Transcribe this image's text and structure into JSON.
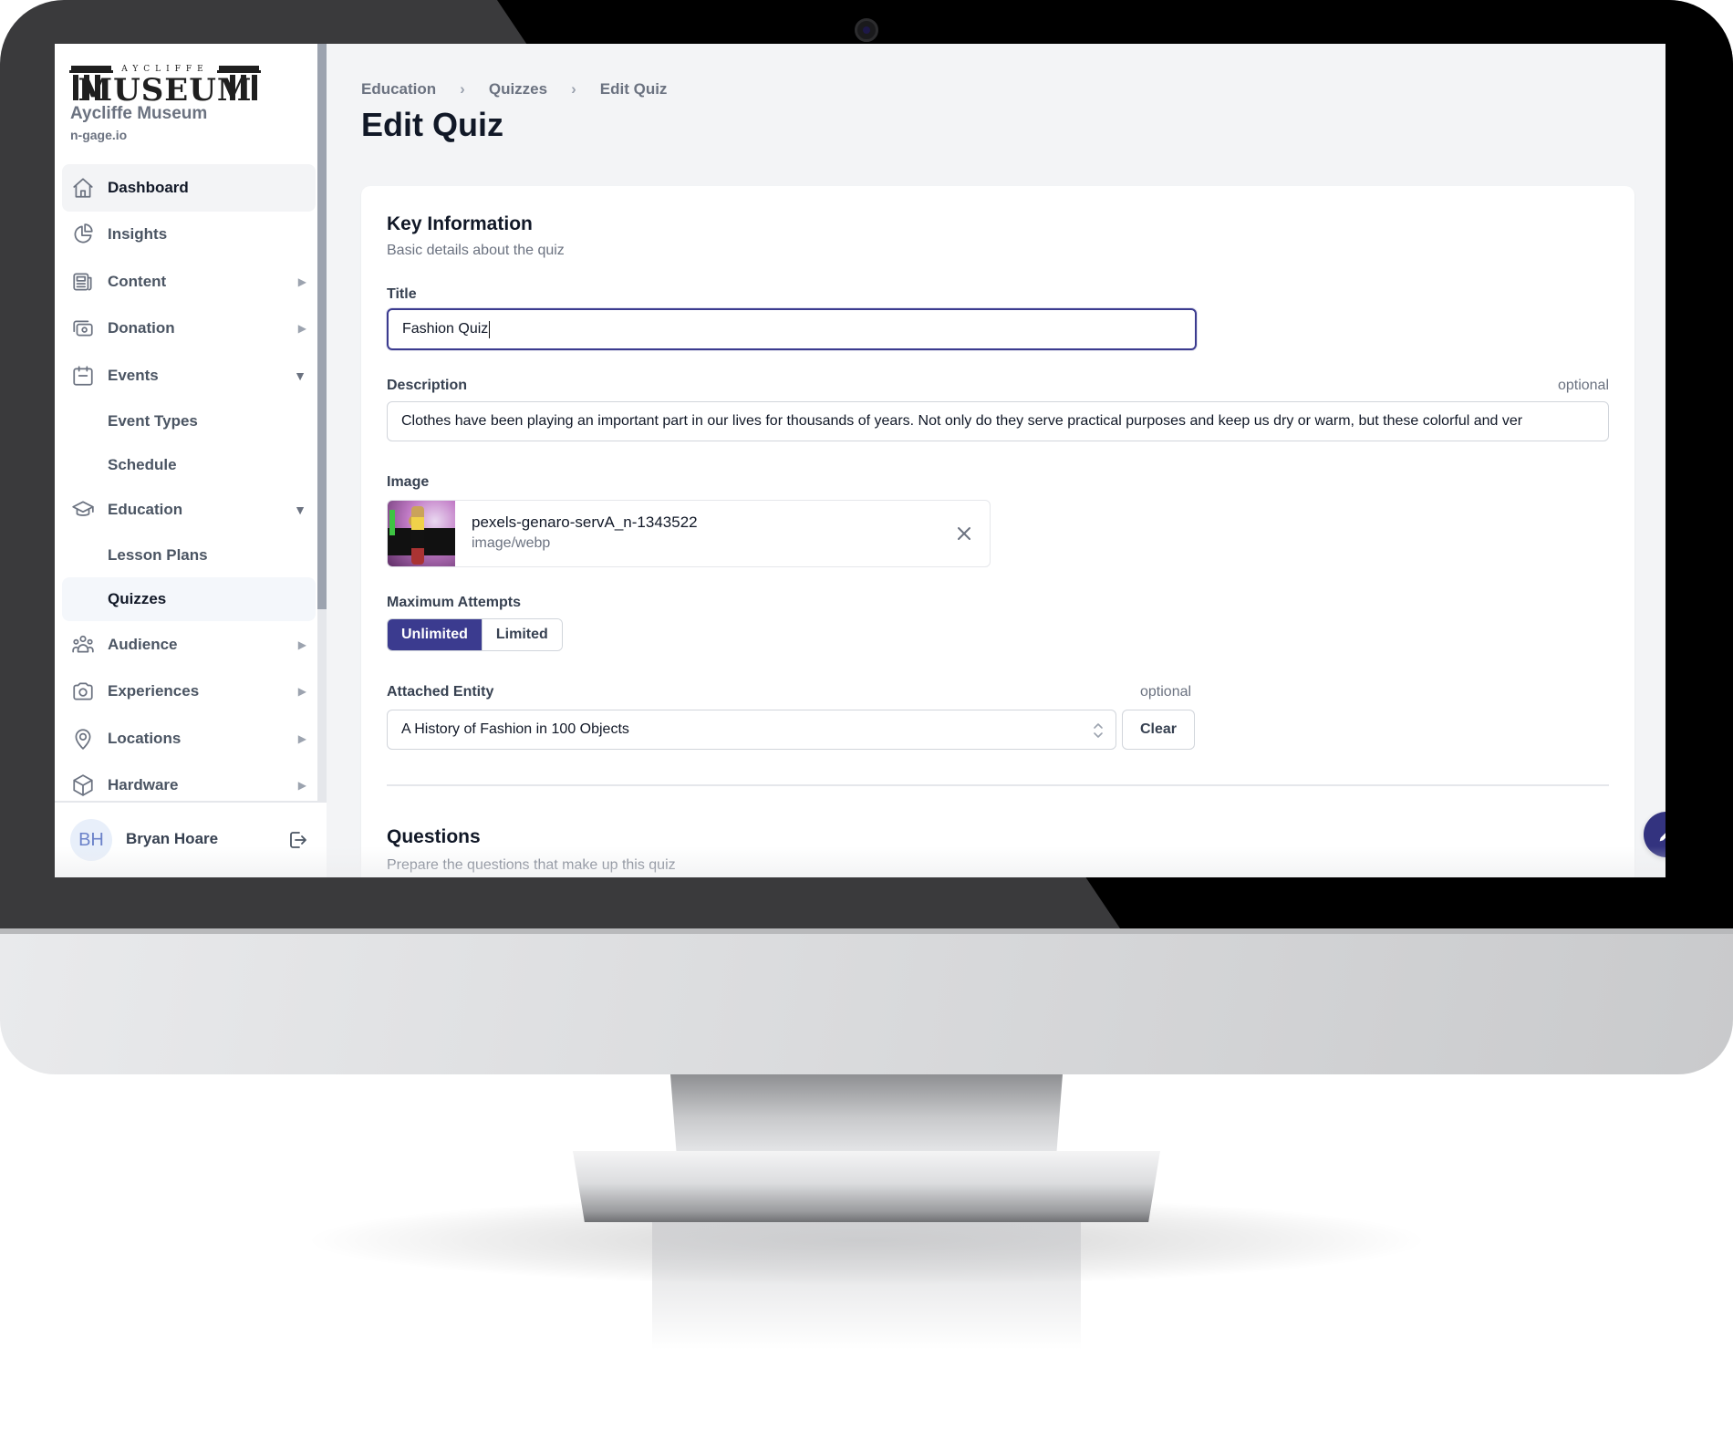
{
  "sidebar": {
    "logo": {
      "small_text": "AYCLIFFE",
      "big_text": "MUSEUM"
    },
    "org_name": "Aycliffe Museum",
    "org_domain": "n-gage.io",
    "items": [
      {
        "label": "Dashboard",
        "icon": "home-icon",
        "active": true
      },
      {
        "label": "Insights",
        "icon": "pie-chart-icon"
      },
      {
        "label": "Content",
        "icon": "newspaper-icon",
        "chevron": "right"
      },
      {
        "label": "Donation",
        "icon": "cash-icon",
        "chevron": "right"
      },
      {
        "label": "Events",
        "icon": "calendar-icon",
        "chevron": "down",
        "children": [
          {
            "label": "Event Types"
          },
          {
            "label": "Schedule"
          }
        ]
      },
      {
        "label": "Education",
        "icon": "academic-cap-icon",
        "chevron": "down",
        "children": [
          {
            "label": "Lesson Plans"
          },
          {
            "label": "Quizzes",
            "active": true
          }
        ]
      },
      {
        "label": "Audience",
        "icon": "user-group-icon",
        "chevron": "right"
      },
      {
        "label": "Experiences",
        "icon": "camera-icon",
        "chevron": "right"
      },
      {
        "label": "Locations",
        "icon": "location-pin-icon",
        "chevron": "right"
      },
      {
        "label": "Hardware",
        "icon": "cube-icon",
        "chevron": "right"
      }
    ],
    "chevron_right": "▶",
    "chevron_down": "▼",
    "user": {
      "initials": "BH",
      "name": "Bryan Hoare"
    }
  },
  "header": {
    "breadcrumb": [
      "Education",
      "Quizzes",
      "Edit Quiz"
    ],
    "breadcrumb_separator": "›",
    "title": "Edit Quiz"
  },
  "form": {
    "section_title": "Key Information",
    "section_subtitle": "Basic details about the quiz",
    "title_label": "Title",
    "title_value": "Fashion Quiz",
    "description_label": "Description",
    "description_optional": "optional",
    "description_value": "Clothes have been playing an important part in our lives for thousands of years. Not only do they serve practical purposes and keep us dry or warm, but these colorful and ver",
    "image_label": "Image",
    "image_file_name": "pexels-genaro-servA_n-1343522",
    "image_file_type": "image/webp",
    "attempts_label": "Maximum Attempts",
    "attempts_options": [
      "Unlimited",
      "Limited"
    ],
    "attempts_selected": "Unlimited",
    "entity_label": "Attached Entity",
    "entity_optional": "optional",
    "entity_value": "A History of Fashion in 100 Objects",
    "clear_label": "Clear"
  },
  "questions": {
    "title": "Questions",
    "subtitle": "Prepare the questions that make up this quiz"
  },
  "colors": {
    "accent": "#3b3b8f",
    "fab": "#33337f",
    "page_bg": "#f3f4f6"
  }
}
